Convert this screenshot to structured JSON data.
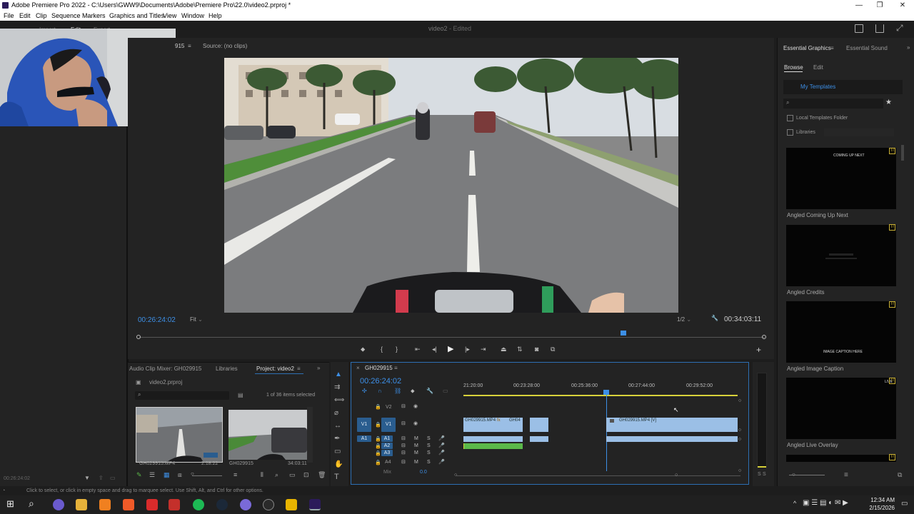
{
  "window": {
    "title": "Adobe Premiere Pro 2022 - C:\\Users\\GWW9\\Documents\\Adobe\\Premiere Pro\\22.0\\video2.prproj *",
    "controls": [
      "—",
      "❐",
      "✕"
    ]
  },
  "menu": [
    "File",
    "Edit",
    "Clip",
    "Sequence",
    "Markers",
    "Graphics and Titles",
    "View",
    "Window",
    "Help"
  ],
  "workspace": {
    "tabs": [
      "Import",
      "Edit",
      "Export"
    ],
    "project_name": "video2",
    "status": "- Edited"
  },
  "source_monitor": {
    "tab_fragment": "915",
    "source_label": "Source: (no clips)"
  },
  "program": {
    "timecode": "00:26:24:02",
    "fit": "Fit",
    "resolution": "1/2",
    "duration": "00:34:03:11"
  },
  "bottom_left": {
    "tabs": [
      "Audio Clip Mixer: GH029915",
      "Libraries",
      "Project: video2"
    ],
    "project_file": "video2.prproj",
    "items_selected": "1 of 36 items selected",
    "clips": [
      {
        "name": "GH029915.MP4",
        "duration": "2:18:22"
      },
      {
        "name": "GH029915",
        "duration": "34:03:11"
      }
    ]
  },
  "timeline": {
    "tab": "GH029915",
    "timecode": "00:26:24:02",
    "ruler": [
      "21:20:00",
      "00:23:28:00",
      "00:25:36:00",
      "00:27:44:00",
      "00:29:52:00"
    ],
    "tracks_video": [
      "V2",
      "V1"
    ],
    "tracks_audio": [
      "A1",
      "A2",
      "A3",
      "A4"
    ],
    "target_v": "V1",
    "target_a": "A1",
    "mix_label": "Mix",
    "mix_value": "0.0",
    "clips": [
      "GH029915.MP4",
      "GH04",
      "GH029915.MP4 [V]"
    ],
    "track_buttons": [
      "M",
      "S"
    ],
    "meter_labels": [
      "S",
      "S"
    ]
  },
  "essential_graphics": {
    "tabs": [
      "Essential Graphics",
      "Essential Sound"
    ],
    "subtabs": [
      "Browse",
      "Edit"
    ],
    "my_templates": "My Templates",
    "local_templates": "Local Templates Folder",
    "libraries": "Libraries",
    "templates": [
      {
        "name": "Angled Coming Up Next",
        "thumb_text": "COMING UP NEXT"
      },
      {
        "name": "Angled Credits",
        "thumb_text": ""
      },
      {
        "name": "Angled Image Caption",
        "thumb_text": "IMAGE CAPTION HERE"
      },
      {
        "name": "Angled Live Overlay",
        "thumb_text": "LIVE"
      }
    ]
  },
  "left_panel": {
    "timecode": "00:26:24:02"
  },
  "status": {
    "hint": "Click to select, or click in empty space and drag to marquee select. Use Shift, Alt, and Ctrl for other options."
  },
  "taskbar": {
    "time": "12:34 AM",
    "date": "2/15/2026"
  },
  "colors": {
    "accent_blue": "#3d8fe6",
    "clip_video": "#9bbfe6",
    "clip_audio_green": "#5bb84a",
    "work_area_yellow": "#d8d23a"
  }
}
